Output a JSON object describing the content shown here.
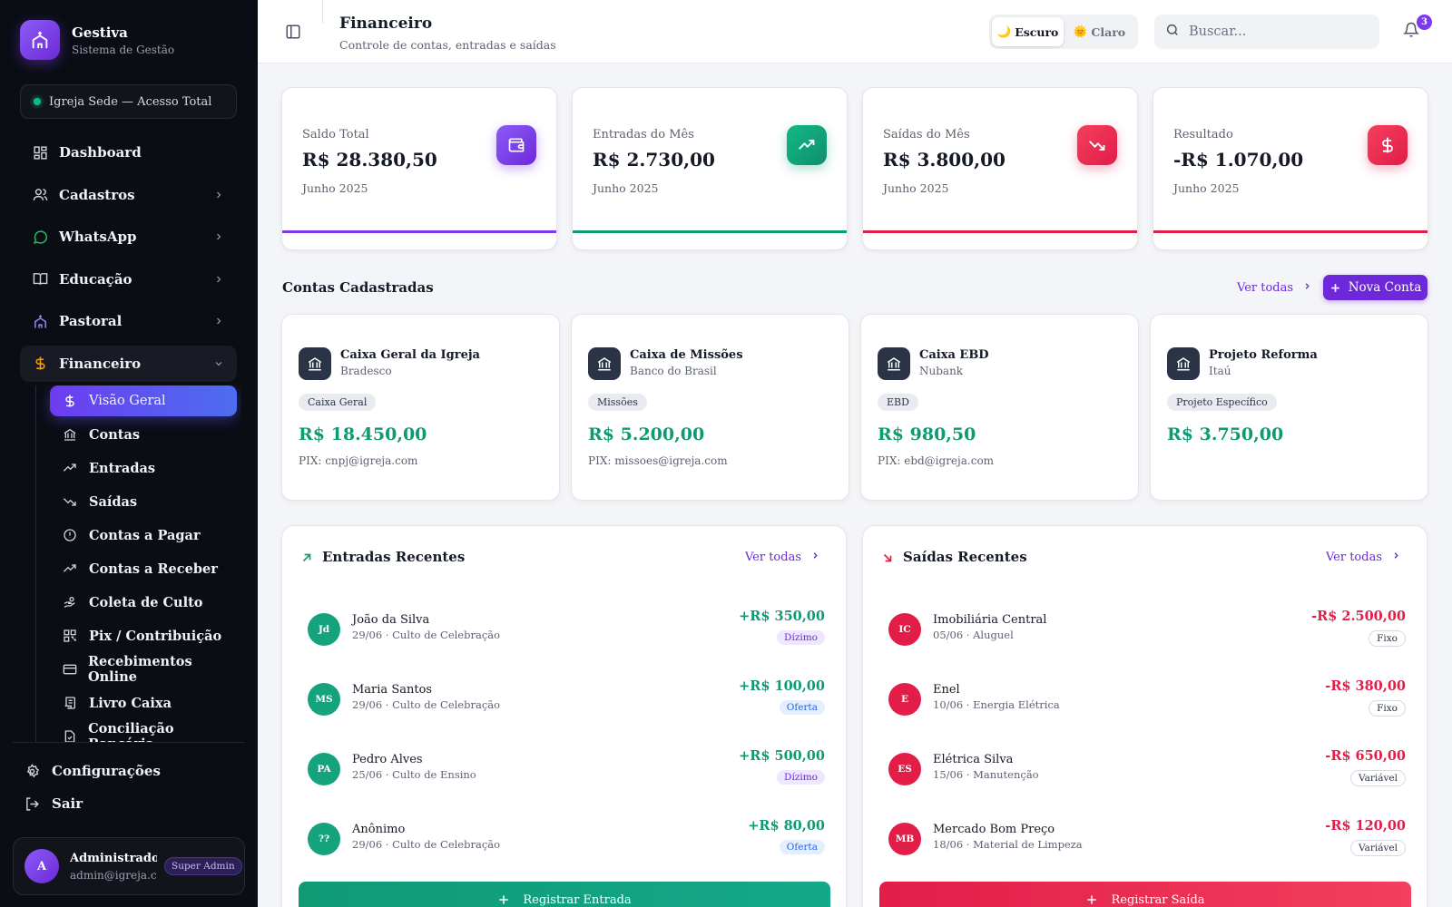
{
  "brand": {
    "name": "Gestiva",
    "subtitle": "Sistema de Gestão"
  },
  "church": {
    "label": "Igreja Sede — Acesso Total"
  },
  "nav": {
    "items": [
      {
        "label": "Dashboard",
        "icon": "grid-icon"
      },
      {
        "label": "Cadastros",
        "icon": "users-icon"
      },
      {
        "label": "WhatsApp",
        "icon": "chat-icon"
      },
      {
        "label": "Educação",
        "icon": "book-icon"
      },
      {
        "label": "Pastoral",
        "icon": "church-icon"
      },
      {
        "label": "Financeiro",
        "icon": "dollar-icon"
      }
    ],
    "sub": [
      {
        "label": "Visão Geral",
        "icon": "dollar-icon"
      },
      {
        "label": "Contas",
        "icon": "bank-icon"
      },
      {
        "label": "Entradas",
        "icon": "trend-up-icon"
      },
      {
        "label": "Saídas",
        "icon": "trend-down-icon"
      },
      {
        "label": "Contas a Pagar",
        "icon": "alert-icon"
      },
      {
        "label": "Contas a Receber",
        "icon": "trend-up-icon"
      },
      {
        "label": "Coleta de Culto",
        "icon": "hand-coins-icon"
      },
      {
        "label": "Pix / Contribuição",
        "icon": "qr-icon"
      },
      {
        "label": "Recebimentos Online",
        "icon": "card-icon"
      },
      {
        "label": "Livro Caixa",
        "icon": "scroll-icon"
      },
      {
        "label": "Conciliação Bancária",
        "icon": "check-file-icon"
      }
    ],
    "settings": "Configurações",
    "logout": "Sair"
  },
  "user": {
    "name": "Administrador",
    "email": "admin@igreja.c...",
    "role": "Super Admin",
    "initial": "A"
  },
  "header": {
    "title": "Financeiro",
    "subtitle": "Controle de contas, entradas e saídas"
  },
  "theme": {
    "dark": "Escuro",
    "light": "Claro",
    "dark_emoji": "🌙",
    "light_emoji": "🌞"
  },
  "search": {
    "placeholder": "Buscar..."
  },
  "notifications": {
    "count": "3"
  },
  "stats": [
    {
      "label": "Saldo Total",
      "value": "R$ 28.380,50",
      "period": "Junho 2025",
      "color": "#7c3aed",
      "icon": "wallet-icon"
    },
    {
      "label": "Entradas do Mês",
      "value": "R$ 2.730,00",
      "period": "Junho 2025",
      "color": "#0f9a74",
      "icon": "trend-up-icon"
    },
    {
      "label": "Saídas do Mês",
      "value": "R$ 3.800,00",
      "period": "Junho 2025",
      "color": "#e11d48",
      "icon": "trend-down-icon"
    },
    {
      "label": "Resultado",
      "value": "-R$ 1.070,00",
      "period": "Junho 2025",
      "color": "#e11d48",
      "icon": "dollar-icon"
    }
  ],
  "accounts_section": {
    "title": "Contas Cadastradas",
    "view_all": "Ver todas",
    "new_button": "Nova Conta"
  },
  "accounts": [
    {
      "name": "Caixa Geral da Igreja",
      "bank": "Bradesco",
      "tag": "Caixa Geral",
      "balance": "R$ 18.450,00",
      "pix": "PIX: cnpj@igreja.com"
    },
    {
      "name": "Caixa de Missões",
      "bank": "Banco do Brasil",
      "tag": "Missões",
      "balance": "R$ 5.200,00",
      "pix": "PIX: missoes@igreja.com"
    },
    {
      "name": "Caixa EBD",
      "bank": "Nubank",
      "tag": "EBD",
      "balance": "R$ 980,50",
      "pix": "PIX: ebd@igreja.com"
    },
    {
      "name": "Projeto Reforma",
      "bank": "Itaú",
      "tag": "Projeto Específico",
      "balance": "R$ 3.750,00",
      "pix": ""
    }
  ],
  "income": {
    "title": "Entradas Recentes",
    "view_all": "Ver todas",
    "button": "Registrar Entrada",
    "items": [
      {
        "initials": "Jd",
        "name": "João da Silva",
        "desc": "29/06 · Culto de Celebração",
        "amount": "+R$ 350,00",
        "tag": "Dízimo"
      },
      {
        "initials": "MS",
        "name": "Maria Santos",
        "desc": "29/06 · Culto de Celebração",
        "amount": "+R$ 100,00",
        "tag": "Oferta"
      },
      {
        "initials": "PA",
        "name": "Pedro Alves",
        "desc": "25/06 · Culto de Ensino",
        "amount": "+R$ 500,00",
        "tag": "Dízimo"
      },
      {
        "initials": "??",
        "name": "Anônimo",
        "desc": "29/06 · Culto de Celebração",
        "amount": "+R$ 80,00",
        "tag": "Oferta"
      }
    ]
  },
  "expenses": {
    "title": "Saídas Recentes",
    "view_all": "Ver todas",
    "button": "Registrar Saída",
    "items": [
      {
        "initials": "IC",
        "name": "Imobiliária Central",
        "desc": "05/06 · Aluguel",
        "amount": "-R$ 2.500,00",
        "tag": "Fixo"
      },
      {
        "initials": "E",
        "name": "Enel",
        "desc": "10/06 · Energia Elétrica",
        "amount": "-R$ 380,00",
        "tag": "Fixo"
      },
      {
        "initials": "ES",
        "name": "Elétrica Silva",
        "desc": "15/06 · Manutenção",
        "amount": "-R$ 650,00",
        "tag": "Variável"
      },
      {
        "initials": "MB",
        "name": "Mercado Bom Preço",
        "desc": "18/06 · Material de Limpeza",
        "amount": "-R$ 120,00",
        "tag": "Variável"
      }
    ]
  }
}
